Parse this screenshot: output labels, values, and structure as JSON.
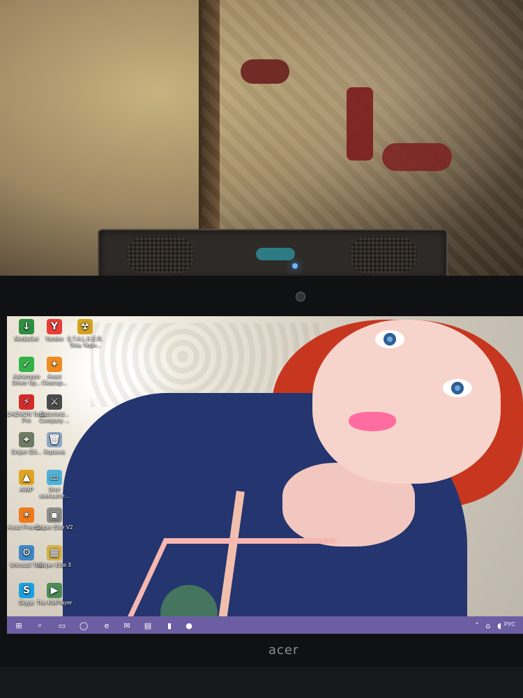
{
  "desktop": {
    "icons": [
      {
        "label": "MediaGet",
        "icon": "mediaget-icon",
        "color": "#2e8d42"
      },
      {
        "label": "Yandex",
        "icon": "yandex-icon",
        "color": "#e93d37"
      },
      {
        "label": "S.T.A.L.K.E.R. Тень Черн...",
        "icon": "stalker-icon",
        "color": "#d6a31e"
      },
      {
        "label": "Ashampoo Driver Up...",
        "icon": "ashampoo-icon",
        "color": "#34b24a"
      },
      {
        "label": "Avast Cleanup...",
        "icon": "avast-cleanup-icon",
        "color": "#ef8b20"
      },
      {
        "label": "DAEMON Tools Pro",
        "icon": "daemon-tools-icon",
        "color": "#d12b2b"
      },
      {
        "label": "Battlefield... Company ...",
        "icon": "battlefield-icon",
        "color": "#4a4a4a"
      },
      {
        "label": "Sniper Elit...",
        "icon": "sniper-elite-icon",
        "color": "#6d7a65"
      },
      {
        "label": "Корзина",
        "icon": "recycle-bin-icon",
        "color": "#8ea9c7"
      },
      {
        "label": "AIMP",
        "icon": "aimp-icon",
        "color": "#e1a524"
      },
      {
        "label": "Этот компьюте...",
        "icon": "this-pc-icon",
        "color": "#4fb3d9"
      },
      {
        "label": "Avast Premiu...",
        "icon": "avast-premium-icon",
        "color": "#ef7b1a"
      },
      {
        "label": "Sniper Elite V2",
        "icon": "sniper-elite-v2-icon",
        "color": "#8e8f88"
      },
      {
        "label": "Uninstall Tool",
        "icon": "uninstall-tool-icon",
        "color": "#3f88c5"
      },
      {
        "label": "Sniper Elite 3",
        "icon": "sniper-elite-3-icon",
        "color": "#d3b04b"
      },
      {
        "label": "Skype",
        "icon": "skype-icon",
        "color": "#1aa1e1"
      },
      {
        "label": "The KMPlayer",
        "icon": "kmplayer-icon",
        "color": "#4d8b57"
      }
    ]
  },
  "taskbar": {
    "language": "РУС",
    "system_tray_icons": [
      "chevron-up-icon",
      "network-icon",
      "volume-icon"
    ],
    "app_icons": [
      "windows-start-icon",
      "search-icon",
      "cortana-icon",
      "task-view-icon",
      "edge-icon",
      "mail-icon",
      "file-explorer-icon",
      "store-icon",
      "media-icon"
    ]
  },
  "device": {
    "brand": "acer"
  },
  "colors": {
    "taskbar": "#6c5ea2"
  }
}
